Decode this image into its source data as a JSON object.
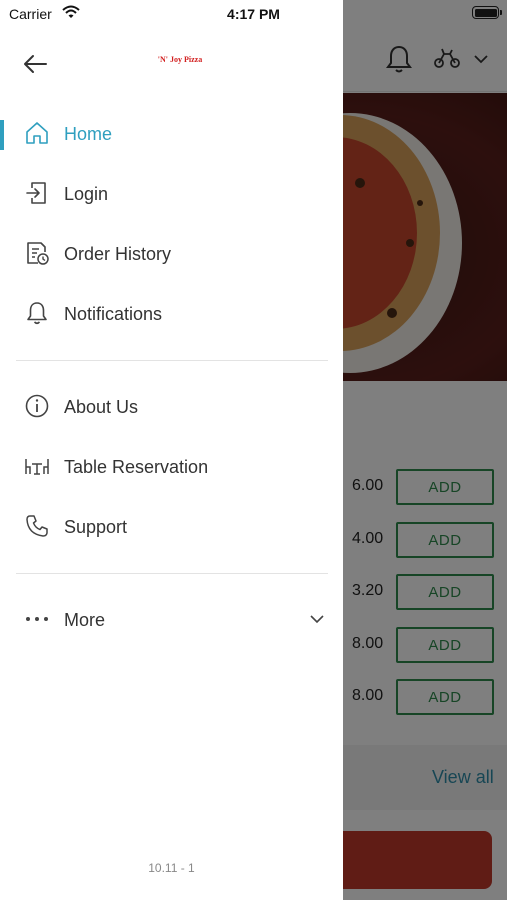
{
  "status_bar": {
    "carrier": "Carrier",
    "time": "4:17 PM"
  },
  "drawer": {
    "logo_text": "'N' Joy Pizza",
    "nav_main": [
      {
        "label": "Home",
        "icon": "home-icon",
        "active": true
      },
      {
        "label": "Login",
        "icon": "login-icon",
        "active": false
      },
      {
        "label": "Order History",
        "icon": "order-history-icon",
        "active": false
      },
      {
        "label": "Notifications",
        "icon": "bell-icon",
        "active": false
      }
    ],
    "nav_secondary": [
      {
        "label": "About Us",
        "icon": "info-icon"
      },
      {
        "label": "Table Reservation",
        "icon": "table-icon"
      },
      {
        "label": "Support",
        "icon": "phone-icon"
      }
    ],
    "more_label": "More",
    "version": "10.11 - 1"
  },
  "background": {
    "items": [
      {
        "price": "6.00",
        "add_label": "ADD"
      },
      {
        "price": "4.00",
        "add_label": "ADD"
      },
      {
        "price": "3.20",
        "add_label": "ADD"
      },
      {
        "price": "8.00",
        "add_label": "ADD"
      },
      {
        "price": "8.00",
        "add_label": "ADD"
      }
    ],
    "view_all": "View all"
  },
  "colors": {
    "accent": "#2f9fbf",
    "add_green": "#2f8a4c",
    "logo_red": "#d21f1f",
    "cta_red": "#c0392b"
  }
}
